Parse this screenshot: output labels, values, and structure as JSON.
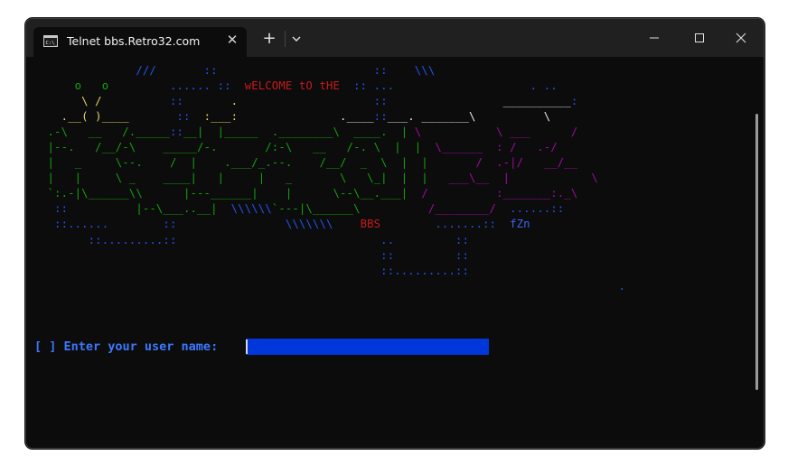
{
  "window": {
    "tab_title": "Telnet bbs.Retro32.com",
    "tab_icon": "terminal-icon",
    "new_tab_label": "+",
    "close_tab_label": "✕",
    "controls": [
      "minimize",
      "maximize",
      "close"
    ]
  },
  "terminal": {
    "ascii_art": [
      {
        "color": "blue",
        "text": "              ///       ::                       ::    \\\\\\"
      },
      {
        "color": "mixed",
        "segments": [
          {
            "c": "green",
            "t": "     o   o"
          },
          {
            "c": "blue",
            "t": "         ...... ::  "
          },
          {
            "c": "red",
            "t": "wELCOME tO tHE"
          },
          {
            "c": "blue",
            "t": "  :: ...                    . .."
          }
        ]
      },
      {
        "color": "mixed",
        "segments": [
          {
            "c": "yellow",
            "t": "      \\ /"
          },
          {
            "c": "blue",
            "t": "          ::       "
          },
          {
            "c": "yellow",
            "t": "."
          },
          {
            "c": "blue",
            "t": "                    ::"
          },
          {
            "c": "white",
            "t": "                 __________"
          },
          {
            "c": "blue",
            "t": ":"
          }
        ]
      },
      {
        "color": "mixed",
        "segments": [
          {
            "c": "yellow",
            "t": "   .__( )____"
          },
          {
            "c": "blue",
            "t": "       ::  "
          },
          {
            "c": "yellow",
            "t": ":___:"
          },
          {
            "c": "white",
            "t": "               .____"
          },
          {
            "c": "blue",
            "t": "::"
          },
          {
            "c": "white",
            "t": "___. _______\\          \\"
          }
        ]
      },
      {
        "color": "mixed",
        "segments": [
          {
            "c": "green",
            "t": " .-\\   __   /._____"
          },
          {
            "c": "blue",
            "t": "::"
          },
          {
            "c": "green",
            "t": "__|  |_____  .________\\  ____.  | "
          },
          {
            "c": "magenta",
            "t": "\\           \\ ___      /"
          }
        ]
      },
      {
        "color": "mixed",
        "segments": [
          {
            "c": "green",
            "t": " |--.   /__/-\\    _____/-.       /:-\\   __   /-. \\  |  | "
          },
          {
            "c": "magenta",
            "t": " \\______  : /   .-/"
          }
        ]
      },
      {
        "color": "mixed",
        "segments": [
          {
            "c": "green",
            "t": " |   _     \\--.    /  |    .___/_.--.    /__/  _  \\  |  | "
          },
          {
            "c": "magenta",
            "t": "      /  .-|/   __/__"
          }
        ]
      },
      {
        "color": "mixed",
        "segments": [
          {
            "c": "green",
            "t": " |   |     \\ _    ____|   |     |   _       \\   \\_|  |  | "
          },
          {
            "c": "magenta",
            "t": "  ___\\__  |            \\"
          }
        ]
      },
      {
        "color": "mixed",
        "segments": [
          {
            "c": "green",
            "t": " `:.-|\\______\\\\      |---______|    |      \\--\\__.___|  "
          },
          {
            "c": "magenta",
            "t": "/          :_______:._\\"
          }
        ]
      },
      {
        "color": "mixed",
        "segments": [
          {
            "c": "blue",
            "t": "  ::          "
          },
          {
            "c": "green",
            "t": "|--\\___..__|"
          },
          {
            "c": "blue",
            "t": "  \\\\\\\\\\\\"
          },
          {
            "c": "green",
            "t": "`---|\\______\\"
          },
          {
            "c": "magenta",
            "t": "          /________/  "
          },
          {
            "c": "blue",
            "t": "......::"
          }
        ]
      },
      {
        "color": "mixed",
        "segments": [
          {
            "c": "blue",
            "t": "  ::......        ::                \\\\\\\\\\\\\\    "
          },
          {
            "c": "red",
            "t": "BBS"
          },
          {
            "c": "blue",
            "t": "        .......::  "
          },
          {
            "c": "blue2",
            "t": "fZn"
          }
        ]
      },
      {
        "color": "blue",
        "text": "       ::.........::                              ..         ::"
      },
      {
        "color": "blue",
        "text": "                                                  ::         ::"
      },
      {
        "color": "blue",
        "text": "                                                  ::.........::"
      },
      {
        "color": "blue",
        "text": "                                                                                     ."
      }
    ],
    "prompt_label": "[ ] Enter your user name: ",
    "input_value": ""
  }
}
